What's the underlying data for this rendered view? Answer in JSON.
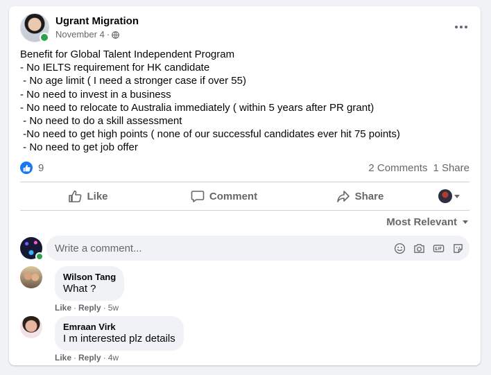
{
  "post": {
    "author": "Ugrant Migration",
    "date": "November 4",
    "date_sep": "·",
    "body_lines": [
      "Benefit for Global Talent Independent Program",
      "- No IELTS requirement for HK candidate",
      " - No age limit ( I need a stronger case if over 55)",
      "- No need to invest in a business",
      "- No need to relocate to Australia immediately ( within 5 years after PR grant)",
      " - No need to do a skill assessment",
      " -No need to get high points ( none of our successful candidates ever hit 75 points)",
      " - No need to get job offer"
    ],
    "reaction_count": "9",
    "comments_count": "2 Comments",
    "shares_count": "1 Share"
  },
  "actions": {
    "like": "Like",
    "comment": "Comment",
    "share": "Share"
  },
  "sort_label": "Most Relevant",
  "composer": {
    "placeholder": "Write a comment..."
  },
  "comments": [
    {
      "name": "Wilson Tang",
      "text": "What ?",
      "like": "Like",
      "reply": "Reply",
      "sep": "·",
      "time": "5w"
    },
    {
      "name": "Emraan Virk",
      "text": "I m interested plz details",
      "like": "Like",
      "reply": "Reply",
      "sep": "·",
      "time": "4w"
    }
  ],
  "colors": {
    "accent": "#1877f2",
    "online": "#31a24c",
    "secondary_text": "#65676b"
  },
  "icons": [
    "globe-icon",
    "more-options-icon",
    "like-reaction-icon",
    "thumbs-up-icon",
    "comment-icon",
    "share-icon",
    "emoji-icon",
    "camera-icon",
    "gif-icon",
    "sticker-icon",
    "chevron-down-icon"
  ]
}
